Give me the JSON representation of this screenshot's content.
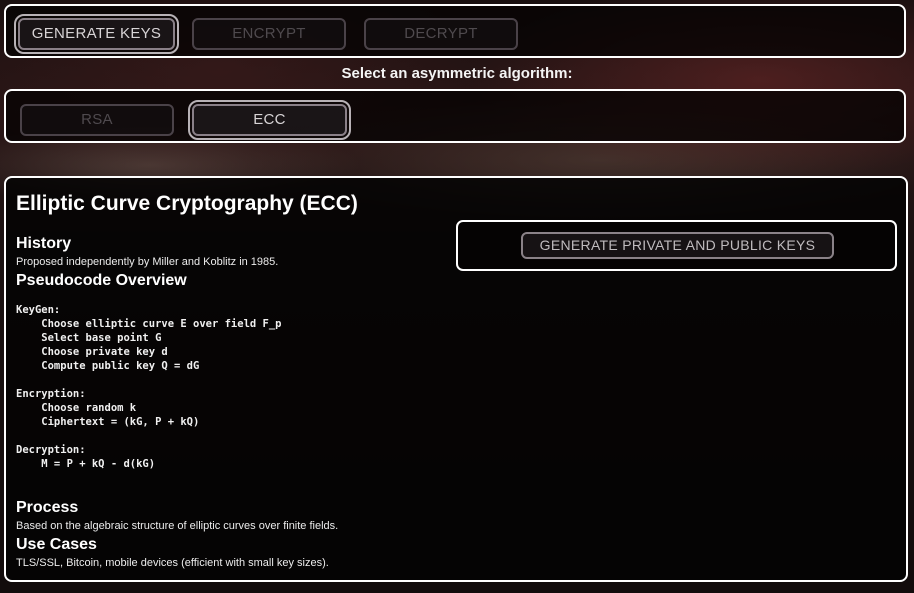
{
  "nav": {
    "generate_label": "GENERATE KEYS",
    "encrypt_label": "ENCRYPT",
    "decrypt_label": "DECRYPT"
  },
  "algorithm_prompt": "Select an asymmetric algorithm:",
  "algorithms": {
    "rsa_label": "RSA",
    "ecc_label": "ECC",
    "selected": "ECC"
  },
  "content": {
    "title": "Elliptic Curve Cryptography (ECC)",
    "history_heading": "History",
    "history_text": "Proposed independently by Miller and Koblitz in 1985.",
    "pseudo_heading": "Pseudocode Overview",
    "pseudocode": "KeyGen:\n    Choose elliptic curve E over field F_p\n    Select base point G\n    Choose private key d\n    Compute public key Q = dG\n\nEncryption:\n    Choose random k\n    Ciphertext = (kG, P + kQ)\n\nDecryption:\n    M = P + kQ - d(kG)",
    "process_heading": "Process",
    "process_text": "Based on the algebraic structure of elliptic curves over finite fields.",
    "usecases_heading": "Use Cases",
    "usecases_text": "TLS/SSL, Bitcoin, mobile devices (efficient with small key sizes)."
  },
  "keygen": {
    "button_label": "GENERATE PRIVATE AND PUBLIC KEYS"
  }
}
